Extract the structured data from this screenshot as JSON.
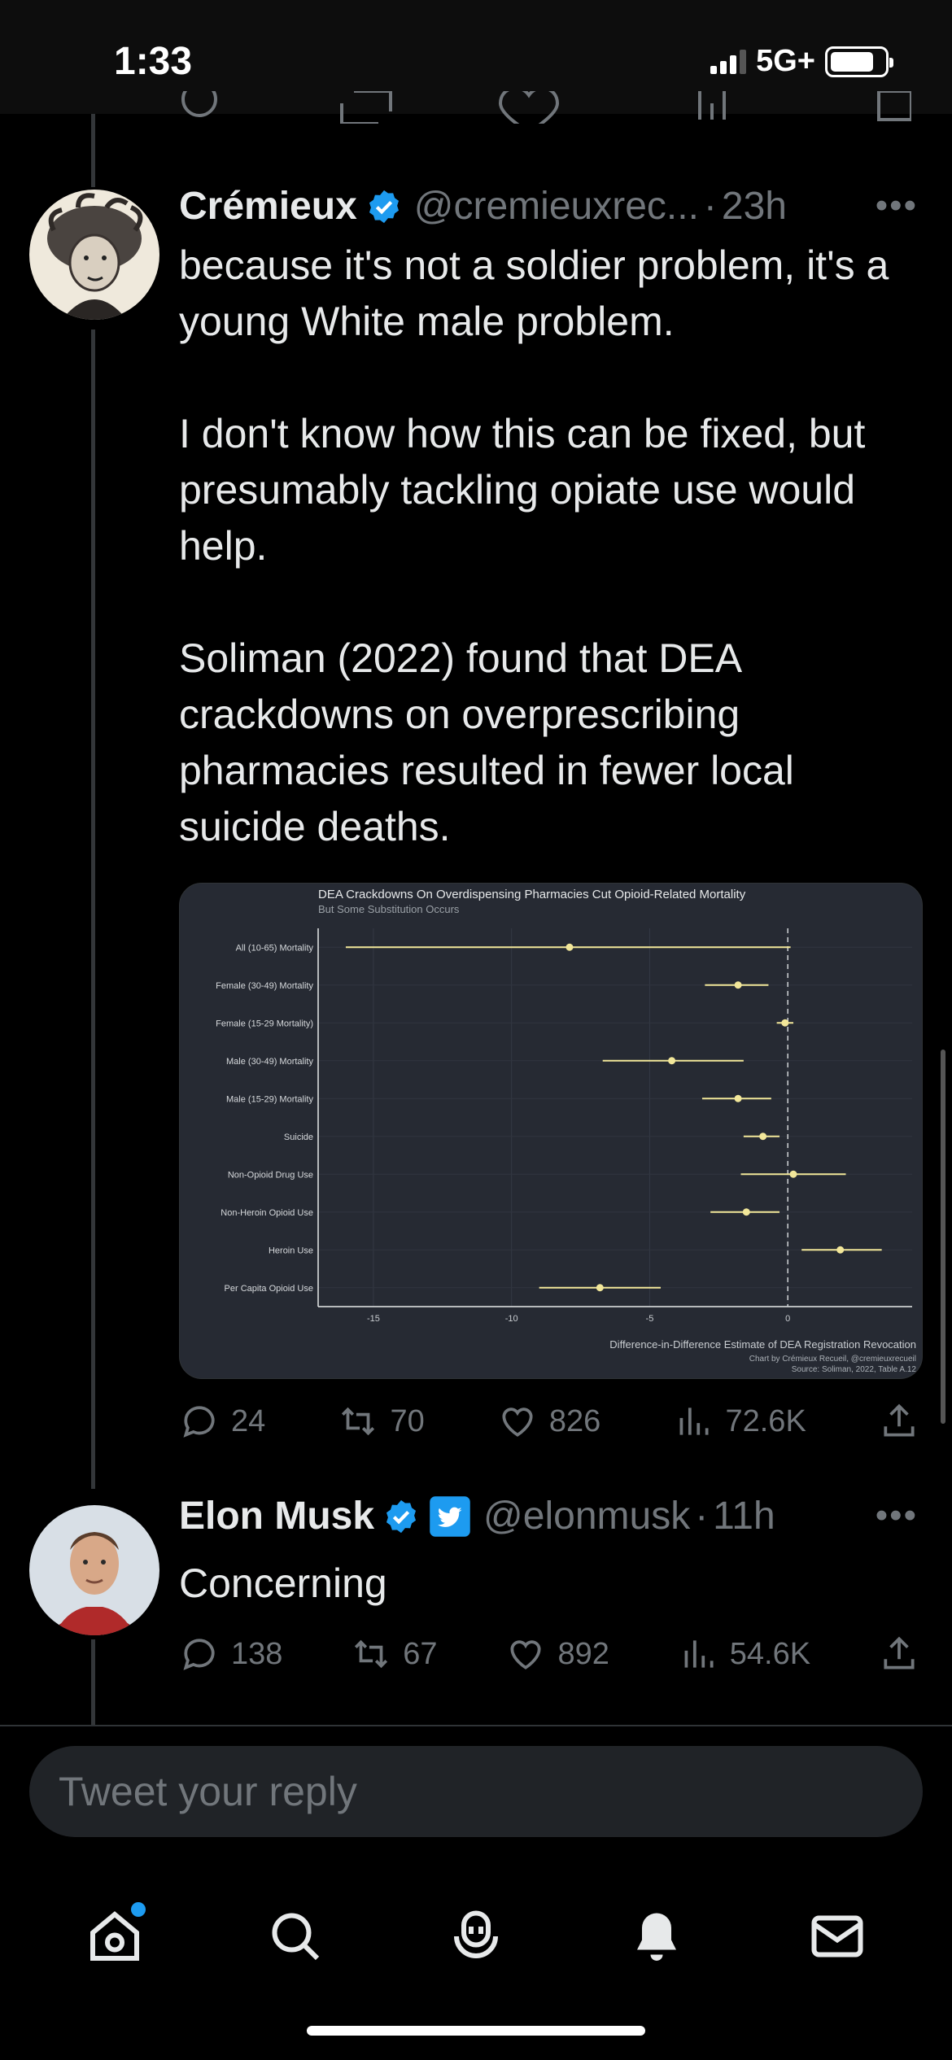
{
  "status_bar": {
    "time": "1:33",
    "network": "5G+"
  },
  "tweets": [
    {
      "name": "Crémieux",
      "handle": "@cremieuxrec...",
      "time": "23h",
      "text": "because it's not a soldier problem, it's a young White male problem.\n\nI don't know how this can be fixed, but presumably tackling opiate use would help.\n\nSoliman (2022) found that DEA crackdowns on overprescribing pharmacies resulted in fewer local suicide deaths.",
      "replies": "24",
      "retweets": "70",
      "likes": "826",
      "views": "72.6K"
    },
    {
      "name": "Elon Musk",
      "handle": "@elonmusk",
      "time": "11h",
      "text": "Concerning",
      "replies": "138",
      "retweets": "67",
      "likes": "892",
      "views": "54.6K"
    }
  ],
  "reply_box": {
    "placeholder": "Tweet your reply"
  },
  "colors": {
    "background": "#000000",
    "accent": "#1d9bf0",
    "muted": "#71767b",
    "chart_bg": "#262a33",
    "chart_mark": "#f2e79a"
  },
  "chart_data": {
    "type": "scatter",
    "subtype": "forest-plot",
    "title": "DEA Crackdowns On Overdispensing Pharmacies Cut Opioid-Related Mortality",
    "subtitle": "But Some Substitution Occurs",
    "xlabel": "Difference-in-Difference Estimate of DEA Registration Revocation",
    "credit": "Chart by Crémieux Recueil, @cremieuxrecueil",
    "source": "Source: Soliman, 2022, Table A.12",
    "xlim": [
      -17,
      4.5
    ],
    "xticks": [
      -15,
      -10,
      -5,
      0
    ],
    "reference_line": 0,
    "categories": [
      "All (10-65) Mortality",
      "Female (30-49) Mortality",
      "Female (15-29 Mortality)",
      "Male (30-49) Mortality",
      "Male (15-29) Mortality",
      "Suicide",
      "Non-Opioid Drug Use",
      "Non-Heroin Opioid Use",
      "Heroin Use",
      "Per Capita Opioid Use"
    ],
    "estimates": [
      -7.9,
      -1.8,
      -0.1,
      -4.2,
      -1.8,
      -0.9,
      0.2,
      -1.5,
      1.9,
      -6.8
    ],
    "ci_low": [
      -16.0,
      -3.0,
      -0.4,
      -6.7,
      -3.1,
      -1.6,
      -1.7,
      -2.8,
      0.5,
      -9.0
    ],
    "ci_high": [
      0.1,
      -0.7,
      0.2,
      -1.6,
      -0.6,
      -0.3,
      2.1,
      -0.3,
      3.4,
      -4.6
    ]
  }
}
